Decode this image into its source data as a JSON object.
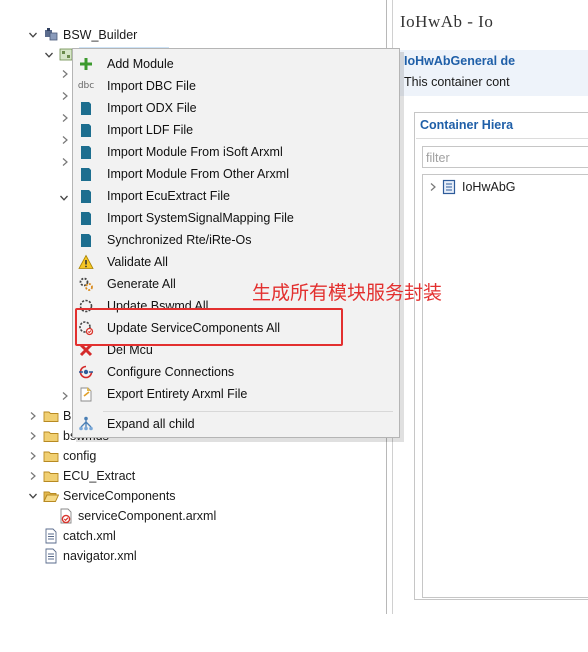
{
  "explorer": {
    "root": {
      "label": "BSW_Builder",
      "icon": "project-icon"
    },
    "visible_items": [
      {
        "label": "BS",
        "icon": "folder-icon"
      },
      {
        "label": "bswmds",
        "icon": "folder-icon"
      },
      {
        "label": "config",
        "icon": "folder-icon"
      },
      {
        "label": "ECU_Extract",
        "icon": "folder-icon"
      },
      {
        "label": "ServiceComponents",
        "icon": "folder-open-icon"
      },
      {
        "label": "serviceComponent.arxml",
        "icon": "arxml-file-icon"
      },
      {
        "label": "catch.xml",
        "icon": "xml-file-icon"
      },
      {
        "label": "navigator.xml",
        "icon": "xml-file-icon"
      }
    ]
  },
  "context_menu": {
    "items": [
      {
        "label": "Add Module",
        "icon": "add-icon"
      },
      {
        "label": "Import DBC File",
        "icon": "dbc-icon",
        "icon_text": "dbc"
      },
      {
        "label": "Import ODX File",
        "icon": "import-icon"
      },
      {
        "label": "Import LDF File",
        "icon": "import-icon"
      },
      {
        "label": "Import Module From iSoft Arxml",
        "icon": "import-icon"
      },
      {
        "label": "Import Module From Other Arxml",
        "icon": "import-icon"
      },
      {
        "label": "Import EcuExtract File",
        "icon": "import-icon"
      },
      {
        "label": "Import SystemSignalMapping File",
        "icon": "import-icon"
      },
      {
        "label": "Synchronized Rte/iRte-Os",
        "icon": "sync-icon"
      },
      {
        "label": "Validate All",
        "icon": "warning-icon"
      },
      {
        "label": "Generate All",
        "icon": "generate-icon"
      },
      {
        "label": "Update Bswmd All",
        "icon": "update-icon"
      },
      {
        "label": "Update ServiceComponents All",
        "icon": "update-service-icon"
      },
      {
        "label": "Del Mcu",
        "icon": "delete-icon"
      },
      {
        "label": "Configure Connections",
        "icon": "connections-icon"
      },
      {
        "label": "Export Entirety Arxml File",
        "icon": "export-icon"
      },
      {
        "label": "Expand all child",
        "icon": "expand-tree-icon"
      }
    ]
  },
  "editor": {
    "title": "IoHwAb - Io",
    "section_title": "IoHwAbGeneral de",
    "section_desc": "This container cont",
    "panel_title": "Container Hiera",
    "filter_placeholder": "filter",
    "tree_item": "IoHwAbG"
  },
  "annotation": {
    "text": "生成所有模块服务封装",
    "color": "#e3302f"
  },
  "colors": {
    "menu_bg": "#f2f2f2",
    "accent_blue": "#1f5fa8",
    "folder": "#e8c15a"
  }
}
